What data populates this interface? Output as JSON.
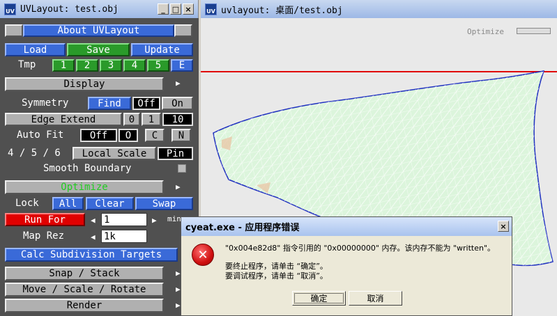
{
  "panel": {
    "title": "UVLayout: test.obj",
    "about": "About UVLayout",
    "load": "Load",
    "save": "Save",
    "update": "Update",
    "tmp_label": "Tmp",
    "tmp_slots": [
      "1",
      "2",
      "3",
      "4",
      "5",
      "E"
    ],
    "display": "Display",
    "symmetry_label": "Symmetry",
    "symmetry_find": "Find",
    "symmetry_off": "Off",
    "symmetry_on": "On",
    "edge_extend": "Edge Extend",
    "edge_vals": [
      "0",
      "1",
      "10"
    ],
    "autofit_label": "Auto Fit",
    "autofit_off": "Off",
    "autofit_opts": [
      "O",
      "C",
      "N"
    ],
    "local_scale_nums": "4 / 5 / 6",
    "local_scale": "Local Scale",
    "pin": "Pin",
    "smooth_boundary": "Smooth Boundary",
    "optimize": "Optimize",
    "lock_label": "Lock",
    "lock_all": "All",
    "lock_clear": "Clear",
    "lock_swap": "Swap",
    "run_for": "Run For",
    "run_for_value": "1",
    "run_for_unit": "min",
    "map_rez_label": "Map Rez",
    "map_rez_value": "1k",
    "calc_subdiv": "Calc Subdivision Targets",
    "snap_stack": "Snap / Stack",
    "move_scale_rotate": "Move / Scale / Rotate",
    "render": "Render"
  },
  "viewport": {
    "title": "uvlayout: 桌面/test.obj",
    "optimize_label": "Optimize"
  },
  "dialog": {
    "title": "cyeat.exe - 应用程序错误",
    "line1": "\"0x004e82d8\" 指令引用的 \"0x00000000\" 内存。该内存不能为 \"written\"。",
    "line2": "要终止程序，请单击 “确定”。",
    "line3": "要调试程序，请单击 “取消”。",
    "ok": "确定",
    "cancel": "取消"
  },
  "colors": {
    "accent_blue": "#3a6ad8",
    "accent_green": "#2a9a2a",
    "run_red": "#e00000",
    "mesh_fill": "#dcf5dc",
    "boundary_red": "#e00000"
  }
}
